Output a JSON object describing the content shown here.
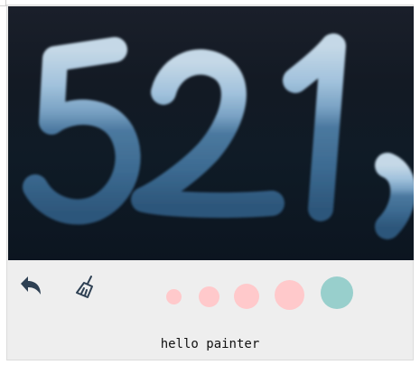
{
  "canvas": {
    "drawing_text": "521",
    "background_theme": "night-sea-sky"
  },
  "toolbar": {
    "undo_icon": "undo-arrow-icon",
    "clear_icon": "broom-icon",
    "brush_sizes": [
      {
        "size": "xs",
        "color": "#ffc9cb"
      },
      {
        "size": "s",
        "color": "#ffc9cb"
      },
      {
        "size": "m",
        "color": "#ffc9cb"
      },
      {
        "size": "l",
        "color": "#ffc9cb"
      },
      {
        "size": "xl",
        "color": "#98cfcc",
        "selected": true
      }
    ]
  },
  "caption": "hello painter",
  "colors": {
    "accent": "#98cfcc",
    "brush": "#ffc9cb",
    "icon": "#2e4053"
  }
}
